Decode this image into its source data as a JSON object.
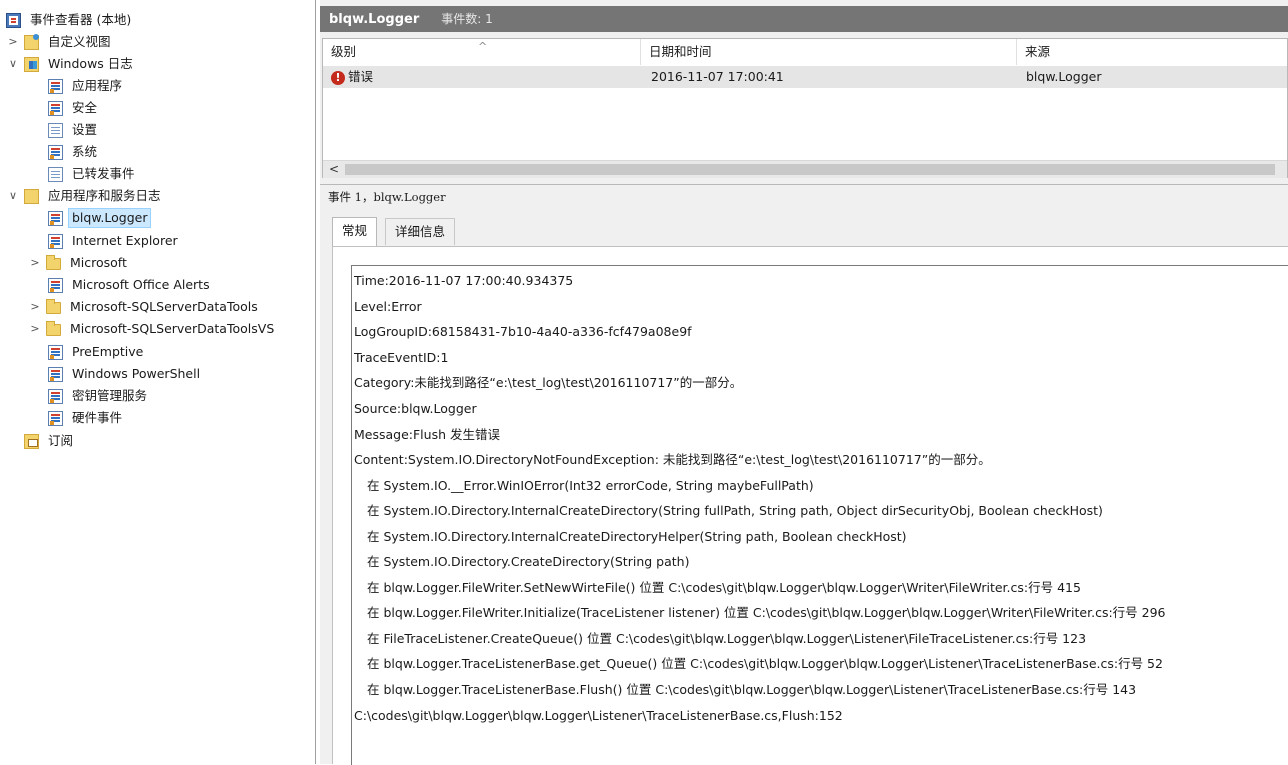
{
  "tree": {
    "items": [
      {
        "label": "事件查看器 (本地)",
        "icon": "event-viewer-root-icon",
        "chevron": ""
      },
      {
        "label": "自定义视图",
        "icon": "custom-views-folder-icon",
        "chevron": ">"
      },
      {
        "label": "Windows 日志",
        "icon": "windows-logs-folder-icon",
        "chevron": "∨"
      },
      {
        "label": "应用程序",
        "icon": "log-icon",
        "chevron": ""
      },
      {
        "label": "安全",
        "icon": "log-icon",
        "chevron": ""
      },
      {
        "label": "设置",
        "icon": "doc-log-icon",
        "chevron": ""
      },
      {
        "label": "系统",
        "icon": "log-icon",
        "chevron": ""
      },
      {
        "label": "已转发事件",
        "icon": "doc-log-icon",
        "chevron": ""
      },
      {
        "label": "应用程序和服务日志",
        "icon": "app-services-folder-icon",
        "chevron": "∨"
      },
      {
        "label": "blqw.Logger",
        "icon": "log-icon",
        "chevron": "",
        "selected": true
      },
      {
        "label": "Internet Explorer",
        "icon": "log-icon",
        "chevron": ""
      },
      {
        "label": "Microsoft",
        "icon": "folder-icon",
        "chevron": ">"
      },
      {
        "label": "Microsoft Office Alerts",
        "icon": "log-icon",
        "chevron": ""
      },
      {
        "label": "Microsoft-SQLServerDataTools",
        "icon": "folder-icon",
        "chevron": ">"
      },
      {
        "label": "Microsoft-SQLServerDataToolsVS",
        "icon": "folder-icon",
        "chevron": ">"
      },
      {
        "label": "PreEmptive",
        "icon": "log-icon",
        "chevron": ""
      },
      {
        "label": "Windows PowerShell",
        "icon": "log-icon",
        "chevron": ""
      },
      {
        "label": "密钥管理服务",
        "icon": "log-icon",
        "chevron": ""
      },
      {
        "label": "硬件事件",
        "icon": "log-icon",
        "chevron": ""
      },
      {
        "label": "订阅",
        "icon": "subscriptions-icon",
        "chevron": ""
      }
    ]
  },
  "header": {
    "log_name": "blqw.Logger",
    "event_count": "事件数: 1"
  },
  "event_list": {
    "columns": [
      "级别",
      "日期和时间",
      "来源"
    ],
    "rows": [
      {
        "level": "错误",
        "datetime": "2016-11-07 17:00:41",
        "source": "blqw.Logger"
      }
    ],
    "scroll_left_arrow": "<"
  },
  "detail": {
    "title": "事件 1，blqw.Logger",
    "tabs": [
      "常规",
      "详细信息"
    ],
    "lines": [
      "Time:2016-11-07 17:00:40.934375",
      "Level:Error",
      "LogGroupID:68158431-7b10-4a40-a336-fcf479a08e9f",
      "TraceEventID:1",
      "Category:未能找到路径“e:\\test_log\\test\\2016110717”的一部分。",
      "Source:blqw.Logger",
      "Message:Flush 发生错误",
      "Content:System.IO.DirectoryNotFoundException: 未能找到路径“e:\\test_log\\test\\2016110717”的一部分。",
      "在 System.IO.__Error.WinIOError(Int32 errorCode, String maybeFullPath)",
      "在 System.IO.Directory.InternalCreateDirectory(String fullPath, String path, Object dirSecurityObj, Boolean checkHost)",
      "在 System.IO.Directory.InternalCreateDirectoryHelper(String path, Boolean checkHost)",
      "在 System.IO.Directory.CreateDirectory(String path)",
      "在 blqw.Logger.FileWriter.SetNewWirteFile() 位置 C:\\codes\\git\\blqw.Logger\\blqw.Logger\\Writer\\FileWriter.cs:行号 415",
      "在 blqw.Logger.FileWriter.Initialize(TraceListener listener) 位置 C:\\codes\\git\\blqw.Logger\\blqw.Logger\\Writer\\FileWriter.cs:行号 296",
      "在 FileTraceListener.CreateQueue() 位置 C:\\codes\\git\\blqw.Logger\\blqw.Logger\\Listener\\FileTraceListener.cs:行号 123",
      "在 blqw.Logger.TraceListenerBase.get_Queue() 位置 C:\\codes\\git\\blqw.Logger\\blqw.Logger\\Listener\\TraceListenerBase.cs:行号 52",
      "在 blqw.Logger.TraceListenerBase.Flush() 位置 C:\\codes\\git\\blqw.Logger\\blqw.Logger\\Listener\\TraceListenerBase.cs:行号 143",
      "C:\\codes\\git\\blqw.Logger\\blqw.Logger\\Listener\\TraceListenerBase.cs,Flush:152"
    ]
  },
  "colors": {
    "titlebar": "#757575",
    "selection": "#cce8ff",
    "error": "#c42b1c"
  }
}
